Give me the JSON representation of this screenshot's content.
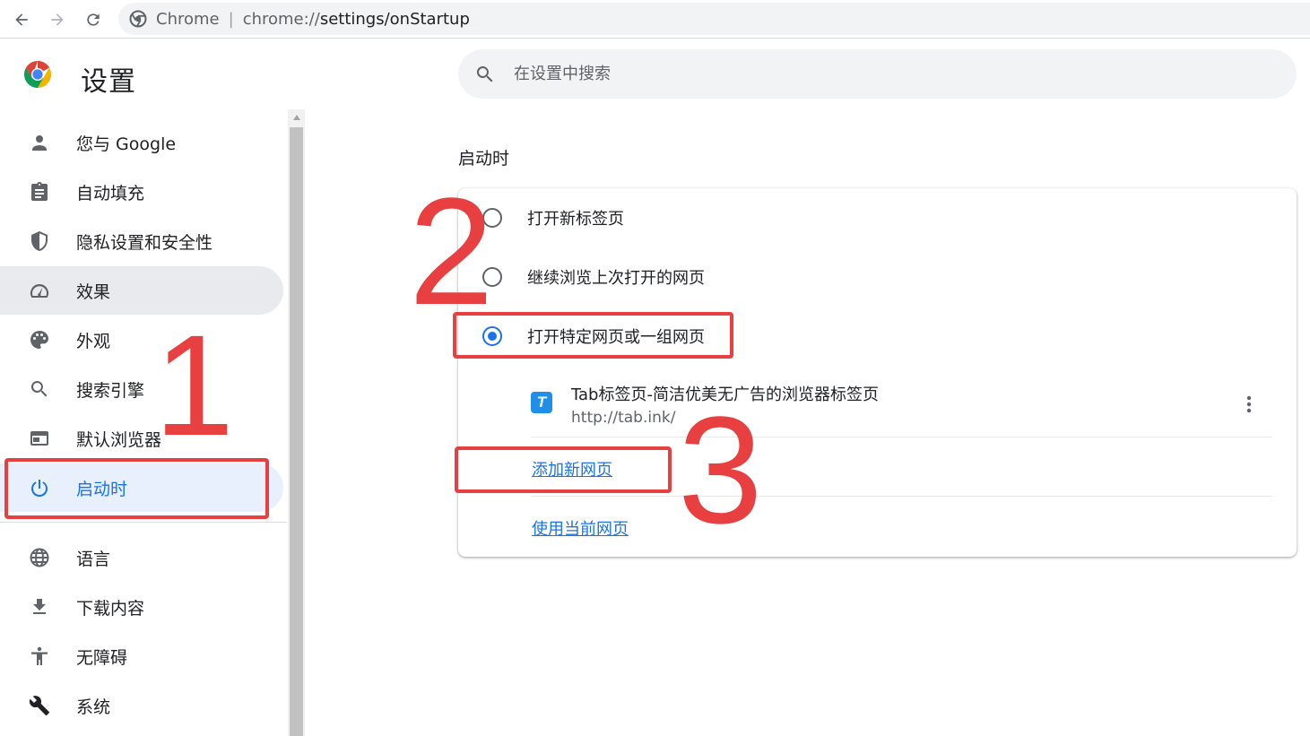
{
  "browser": {
    "chip": "Chrome",
    "url_scheme": "chrome://",
    "url_path": "settings/onStartup"
  },
  "header": {
    "title": "设置",
    "search_placeholder": "在设置中搜索"
  },
  "sidebar": {
    "items": [
      {
        "label": "您与 Google",
        "icon": "person-icon"
      },
      {
        "label": "自动填充",
        "icon": "clipboard-icon"
      },
      {
        "label": "隐私设置和安全性",
        "icon": "shield-icon"
      },
      {
        "label": "效果",
        "icon": "speedometer-icon"
      },
      {
        "label": "外观",
        "icon": "palette-icon"
      },
      {
        "label": "搜索引擎",
        "icon": "search-icon"
      },
      {
        "label": "默认浏览器",
        "icon": "browser-window-icon"
      },
      {
        "label": "启动时",
        "icon": "power-icon"
      },
      {
        "label": "语言",
        "icon": "globe-icon"
      },
      {
        "label": "下载内容",
        "icon": "download-icon"
      },
      {
        "label": "无障碍",
        "icon": "accessibility-icon"
      },
      {
        "label": "系统",
        "icon": "wrench-icon"
      }
    ],
    "active_item": "启动时",
    "hover_item": "效果"
  },
  "main": {
    "section_title": "启动时",
    "options": [
      {
        "label": "打开新标签页",
        "checked": false
      },
      {
        "label": "继续浏览上次打开的网页",
        "checked": false
      },
      {
        "label": "打开特定网页或一组网页",
        "checked": true
      }
    ],
    "startup_page": {
      "title": "Tab标签页-简洁优美无广告的浏览器标签页",
      "url": "http://tab.ink/",
      "favicon_letter": "T"
    },
    "add_page_link": "添加新网页",
    "use_current_link": "使用当前网页"
  },
  "annotations": {
    "step1": "1",
    "step2": "2",
    "step3": "3",
    "color": "#e84040"
  },
  "colors": {
    "accent": "#1a73e8",
    "active_bg": "#e8f0fe",
    "hover_bg": "#e8eaed",
    "annotation": "#e84040"
  }
}
